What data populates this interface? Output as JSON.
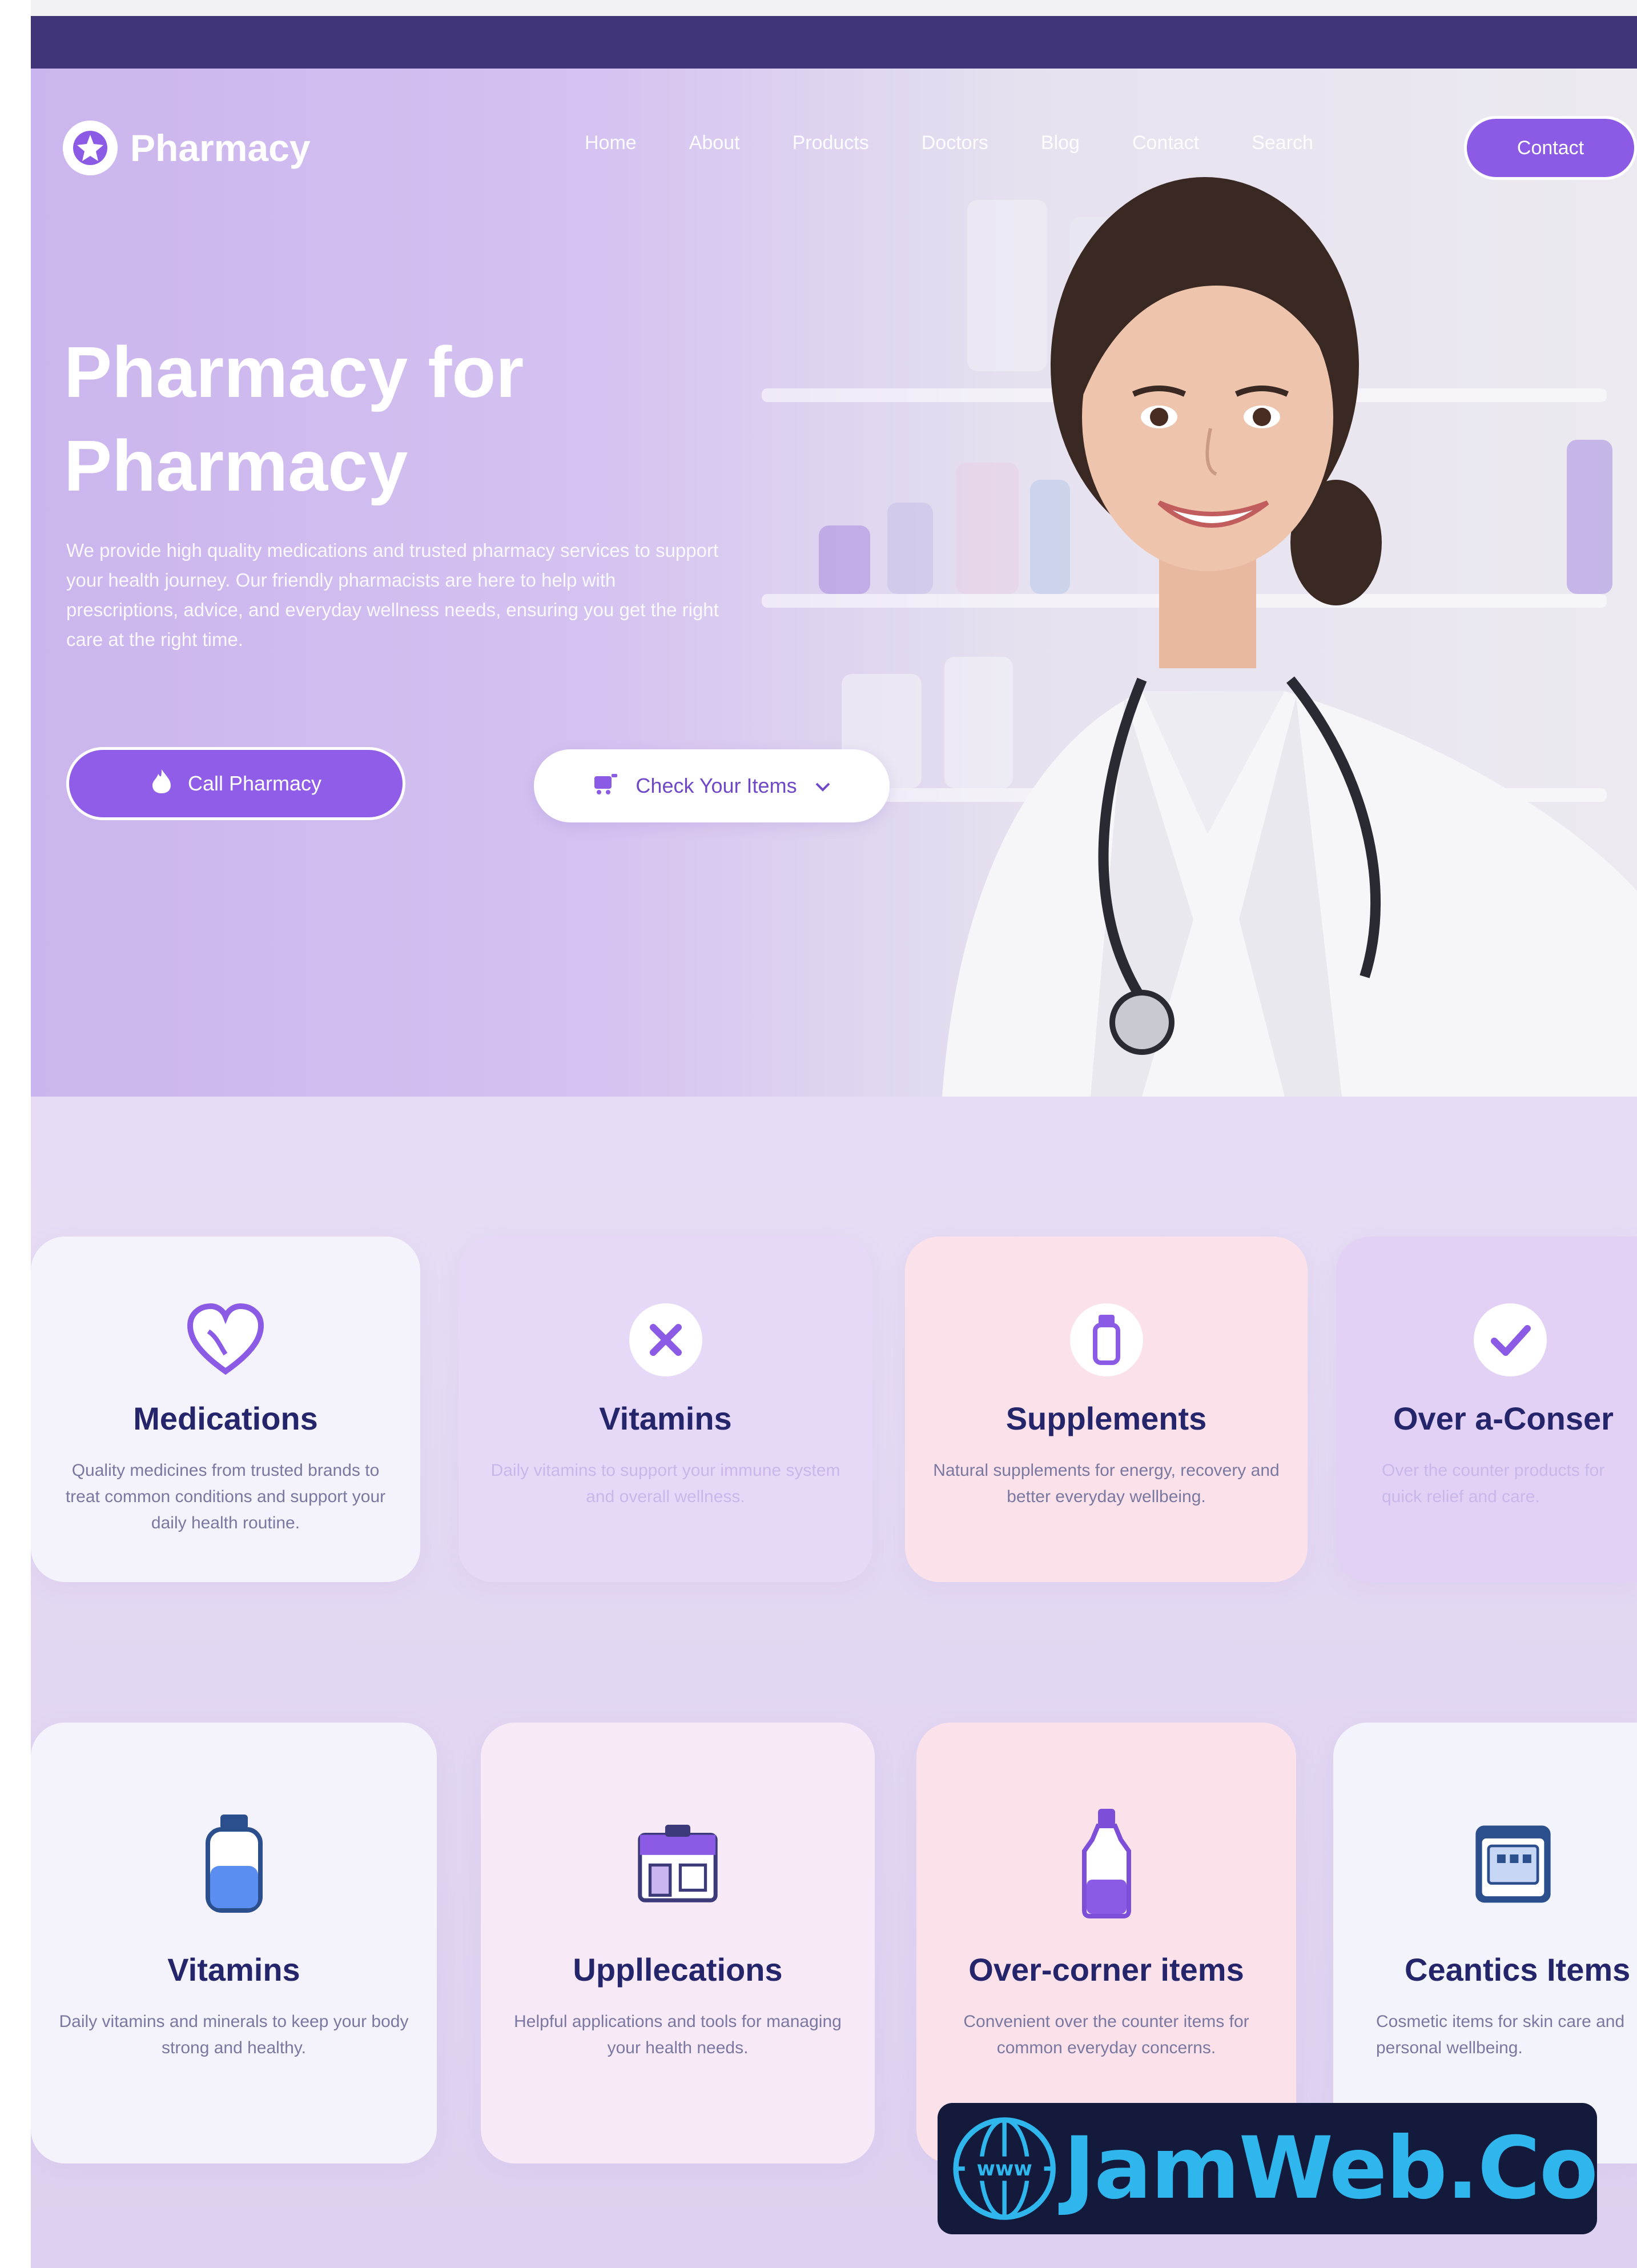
{
  "brand": {
    "name": "Pharmacy"
  },
  "nav": {
    "links": [
      "Home",
      "About",
      "Products",
      "Doctors",
      "Blog",
      "Contact",
      "Search"
    ],
    "cta_label": "Contact"
  },
  "hero": {
    "title_line1": "Pharmacy for",
    "title_line2": "Pharmacy",
    "description": "We provide high quality medications and trusted pharmacy services to support your health journey. Our friendly pharmacists are here to help with prescriptions, advice, and everyday wellness needs, ensuring you get the right care at the right time.",
    "primary_button": "Call Pharmacy",
    "secondary_button": "Check Your Items"
  },
  "categories_row1": [
    {
      "title": "Medications",
      "desc": "Quality medicines from trusted brands to treat common conditions and support your daily health routine.",
      "icon": "heart-icon",
      "bg": "#f4f3fb"
    },
    {
      "title": "Vitamins",
      "desc": "Daily vitamins to support your immune system and overall wellness.",
      "icon": "close-icon",
      "bg": "#e6d8f7"
    },
    {
      "title": "Supplements",
      "desc": "Natural supplements for energy, recovery and better everyday wellbeing.",
      "icon": "bottle-icon",
      "bg": "#fbe2ea"
    },
    {
      "title": "Over a-Conser",
      "desc": "Over the counter products for quick relief and care.",
      "icon": "check-icon",
      "bg": "#e2d1f5"
    }
  ],
  "categories_row2": [
    {
      "title": "Vitamins",
      "desc": "Daily vitamins and minerals to keep your body strong and healthy.",
      "icon": "vitamin-bottle-icon",
      "bg": "#f4f3fb"
    },
    {
      "title": "Uppllecations",
      "desc": "Helpful applications and tools for managing your health needs.",
      "icon": "pharmacy-store-icon",
      "bg": "#f8e9f7"
    },
    {
      "title": "Over-corner items",
      "desc": "Convenient over the counter items for common everyday concerns.",
      "icon": "medicine-bottle-icon",
      "bg": "#fbe2ea"
    },
    {
      "title": "Ceantics Items",
      "desc": "Cosmetic items for skin care and personal wellbeing.",
      "icon": "calendar-box-icon",
      "bg": "#f3f4fb"
    }
  ],
  "watermark": {
    "text": "JamWeb.Co",
    "globe_label": "www"
  },
  "colors": {
    "accent": "#8c5be6",
    "topbar": "#3f3577",
    "heading": "#24256a"
  }
}
